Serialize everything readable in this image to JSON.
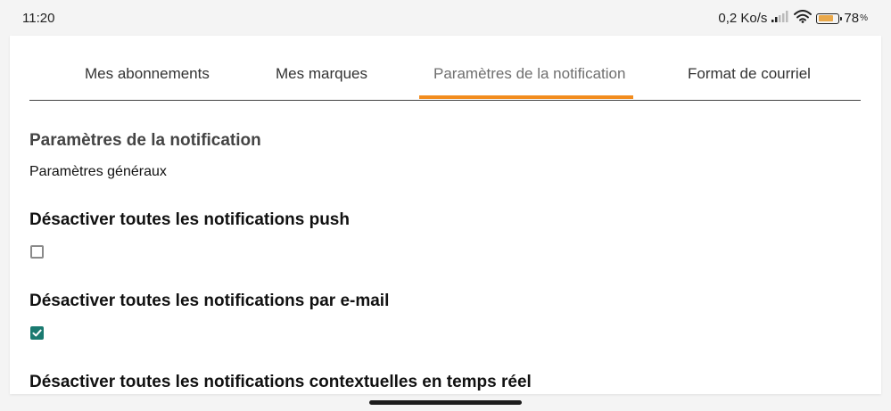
{
  "status_bar": {
    "time": "11:20",
    "network_speed": "0,2 Ko/s",
    "battery_percent": "78",
    "battery_unit": "%",
    "battery_level": 0.78
  },
  "tabs": [
    {
      "label": "Mes abonnements",
      "active": false
    },
    {
      "label": "Mes marques",
      "active": false
    },
    {
      "label": "Paramètres de la notification",
      "active": true
    },
    {
      "label": "Format de courriel",
      "active": false
    }
  ],
  "colors": {
    "accent": "#f28c1e",
    "checkbox_checked": "#1a7a70",
    "battery": "#e9a84a"
  },
  "section": {
    "title": "Paramètres de la notification",
    "subtitle": "Paramètres généraux"
  },
  "options": [
    {
      "label": "Désactiver toutes les notifications push",
      "checked": false
    },
    {
      "label": "Désactiver toutes les notifications par e-mail",
      "checked": true
    },
    {
      "label": "Désactiver toutes les notifications contextuelles en temps réel",
      "checked": false
    }
  ]
}
